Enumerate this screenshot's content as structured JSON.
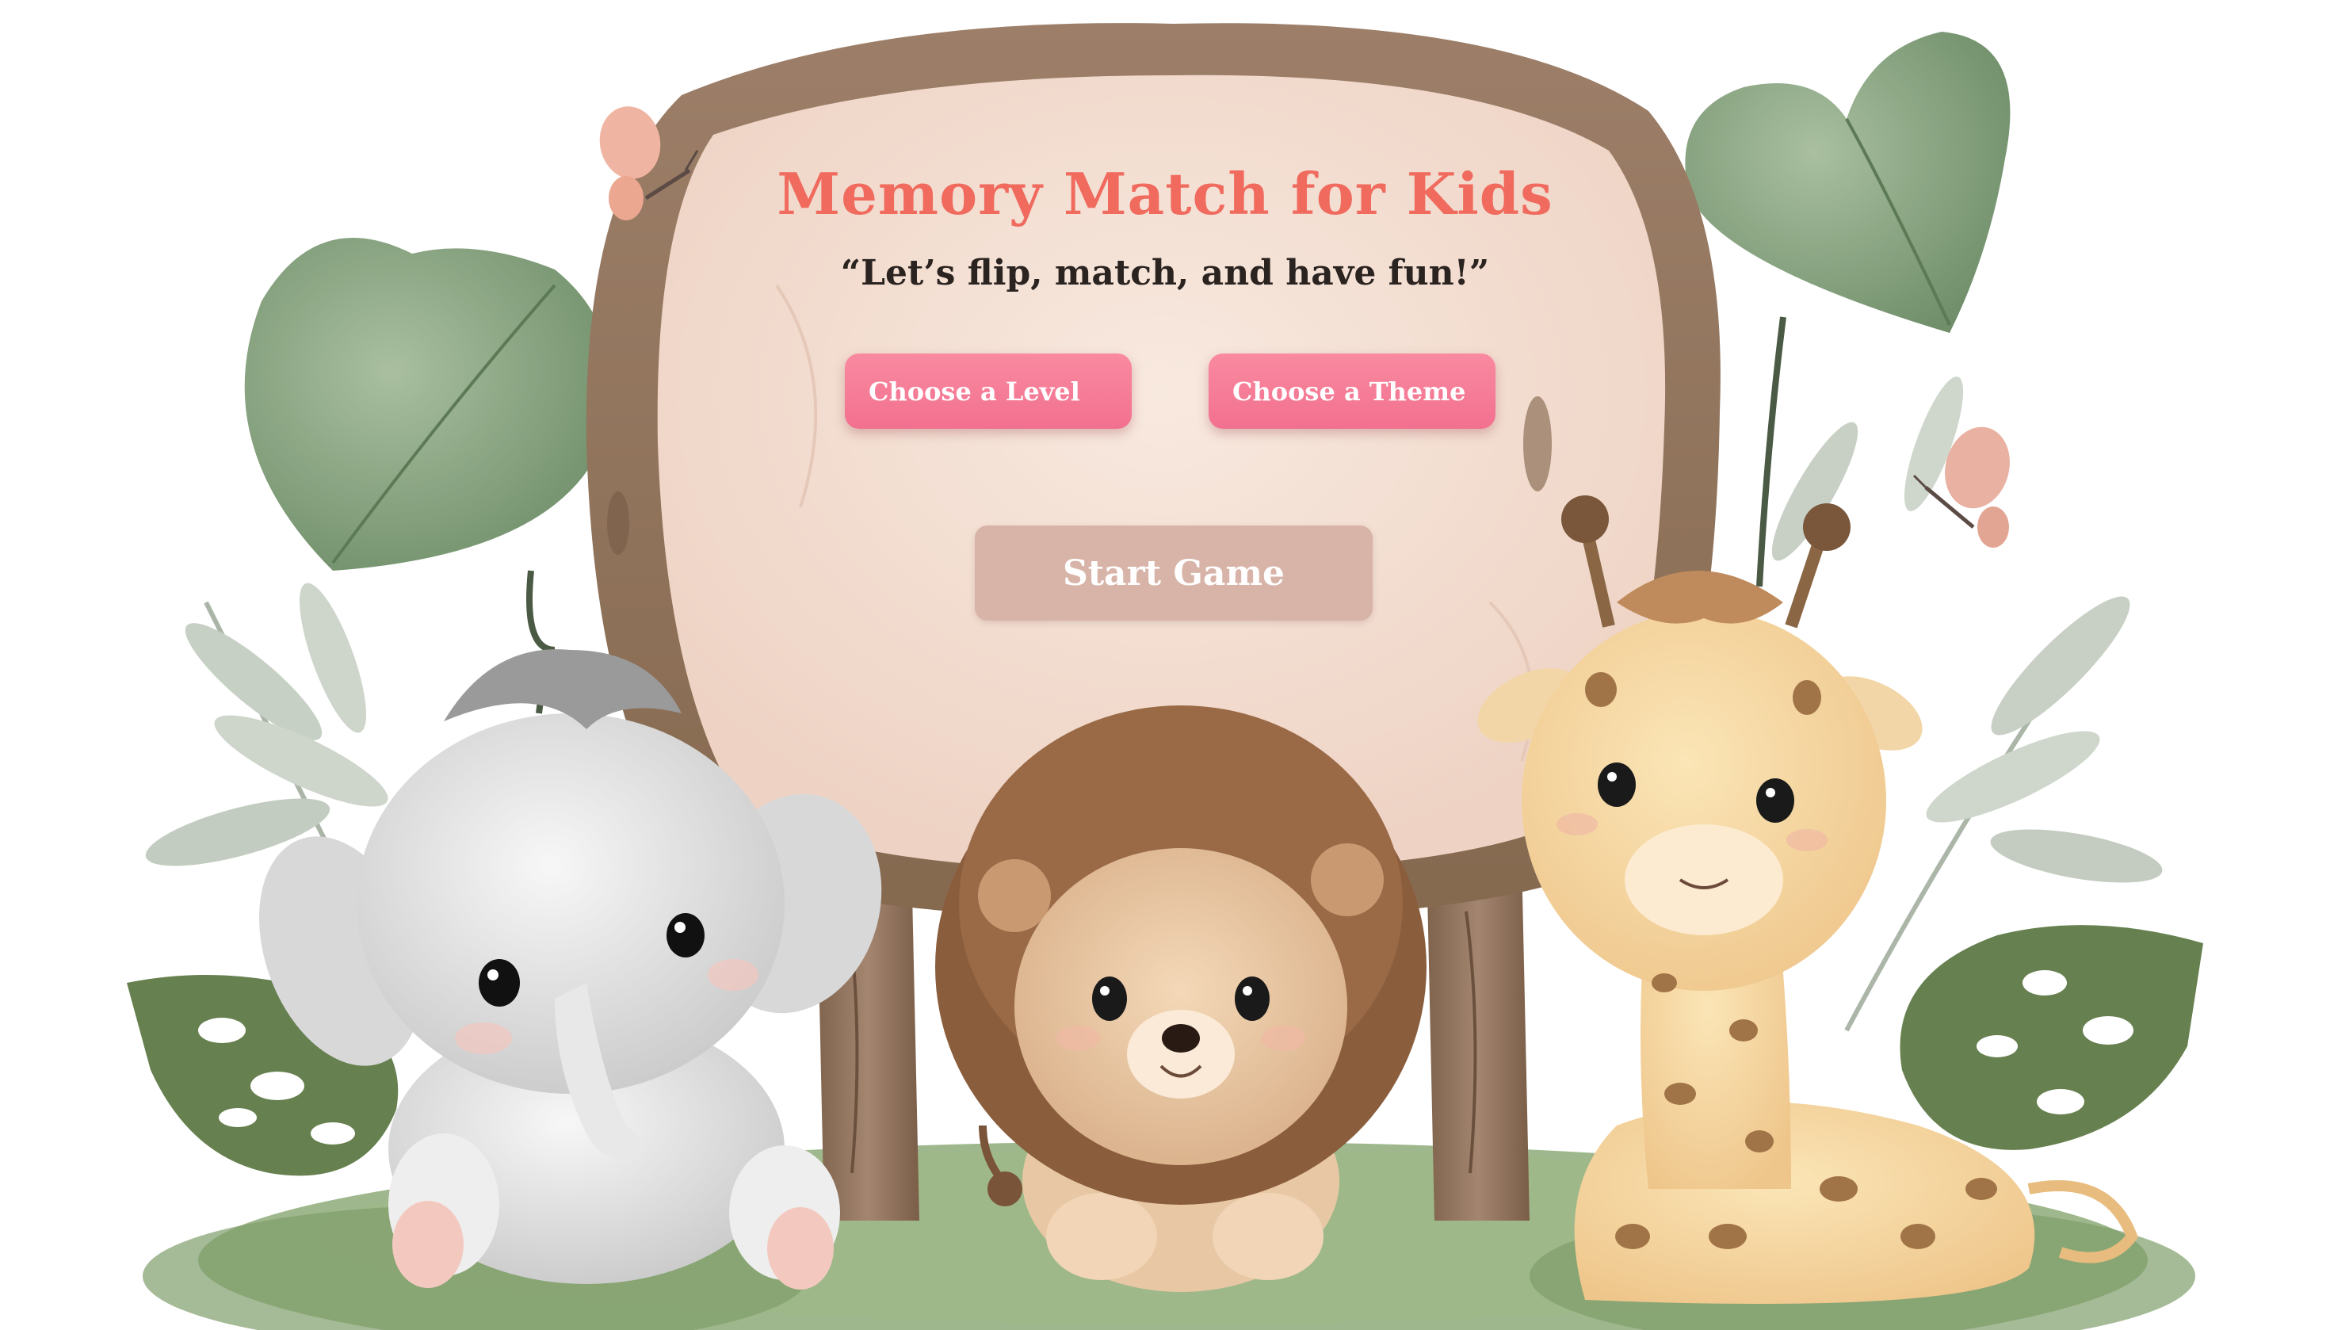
{
  "game": {
    "title": "Memory Match for Kids",
    "tagline": "“Let’s flip, match, and have fun!”"
  },
  "menu": {
    "level_label": "Choose a Level",
    "theme_label": "Choose a Theme",
    "start_label": "Start Game"
  },
  "colors": {
    "title": "#f06a5e",
    "pill_button": "#f47a95",
    "start_button": "#d8b3a8",
    "sign_board": "#f4e1d6",
    "sign_frame": "#9b7c66"
  },
  "scene": {
    "illustrations": [
      "elephant",
      "lion",
      "giraffe",
      "butterfly",
      "butterfly",
      "leaf",
      "monstera-leaf",
      "grass"
    ]
  }
}
